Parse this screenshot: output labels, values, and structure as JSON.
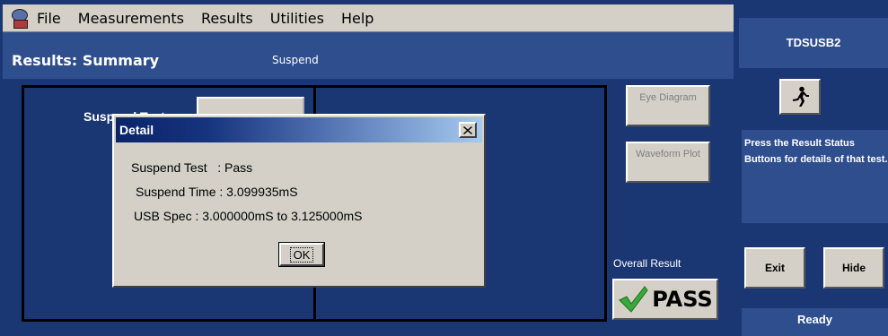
{
  "menu": {
    "items": [
      "File",
      "Measurements",
      "Results",
      "Utilities",
      "Help"
    ]
  },
  "header": {
    "title": "Results: Summary",
    "mode": "Suspend"
  },
  "results": {
    "test_label": "Suspend Test",
    "eye_diagram_label": "Eye Diagram",
    "waveform_plot_label": "Waveform Plot",
    "overall_label": "Overall Result",
    "overall_result": "PASS"
  },
  "right_panel": {
    "title": "TDSUSB2",
    "help_text": "Press the Result Status Buttons for details of that test.",
    "exit_label": "Exit",
    "hide_label": "Hide",
    "status": "Ready"
  },
  "dialog": {
    "title": "Detail",
    "line1": "Suspend Test   : Pass",
    "line2": "Suspend Time : 3.099935mS",
    "line3": "USB Spec : 3.000000mS to 3.125000mS",
    "ok_label": "OK"
  },
  "colors": {
    "background": "#1b3773",
    "panel": "#2f4e8e",
    "button_face": "#d4d0c8",
    "pass_check": "#3aa83a"
  }
}
